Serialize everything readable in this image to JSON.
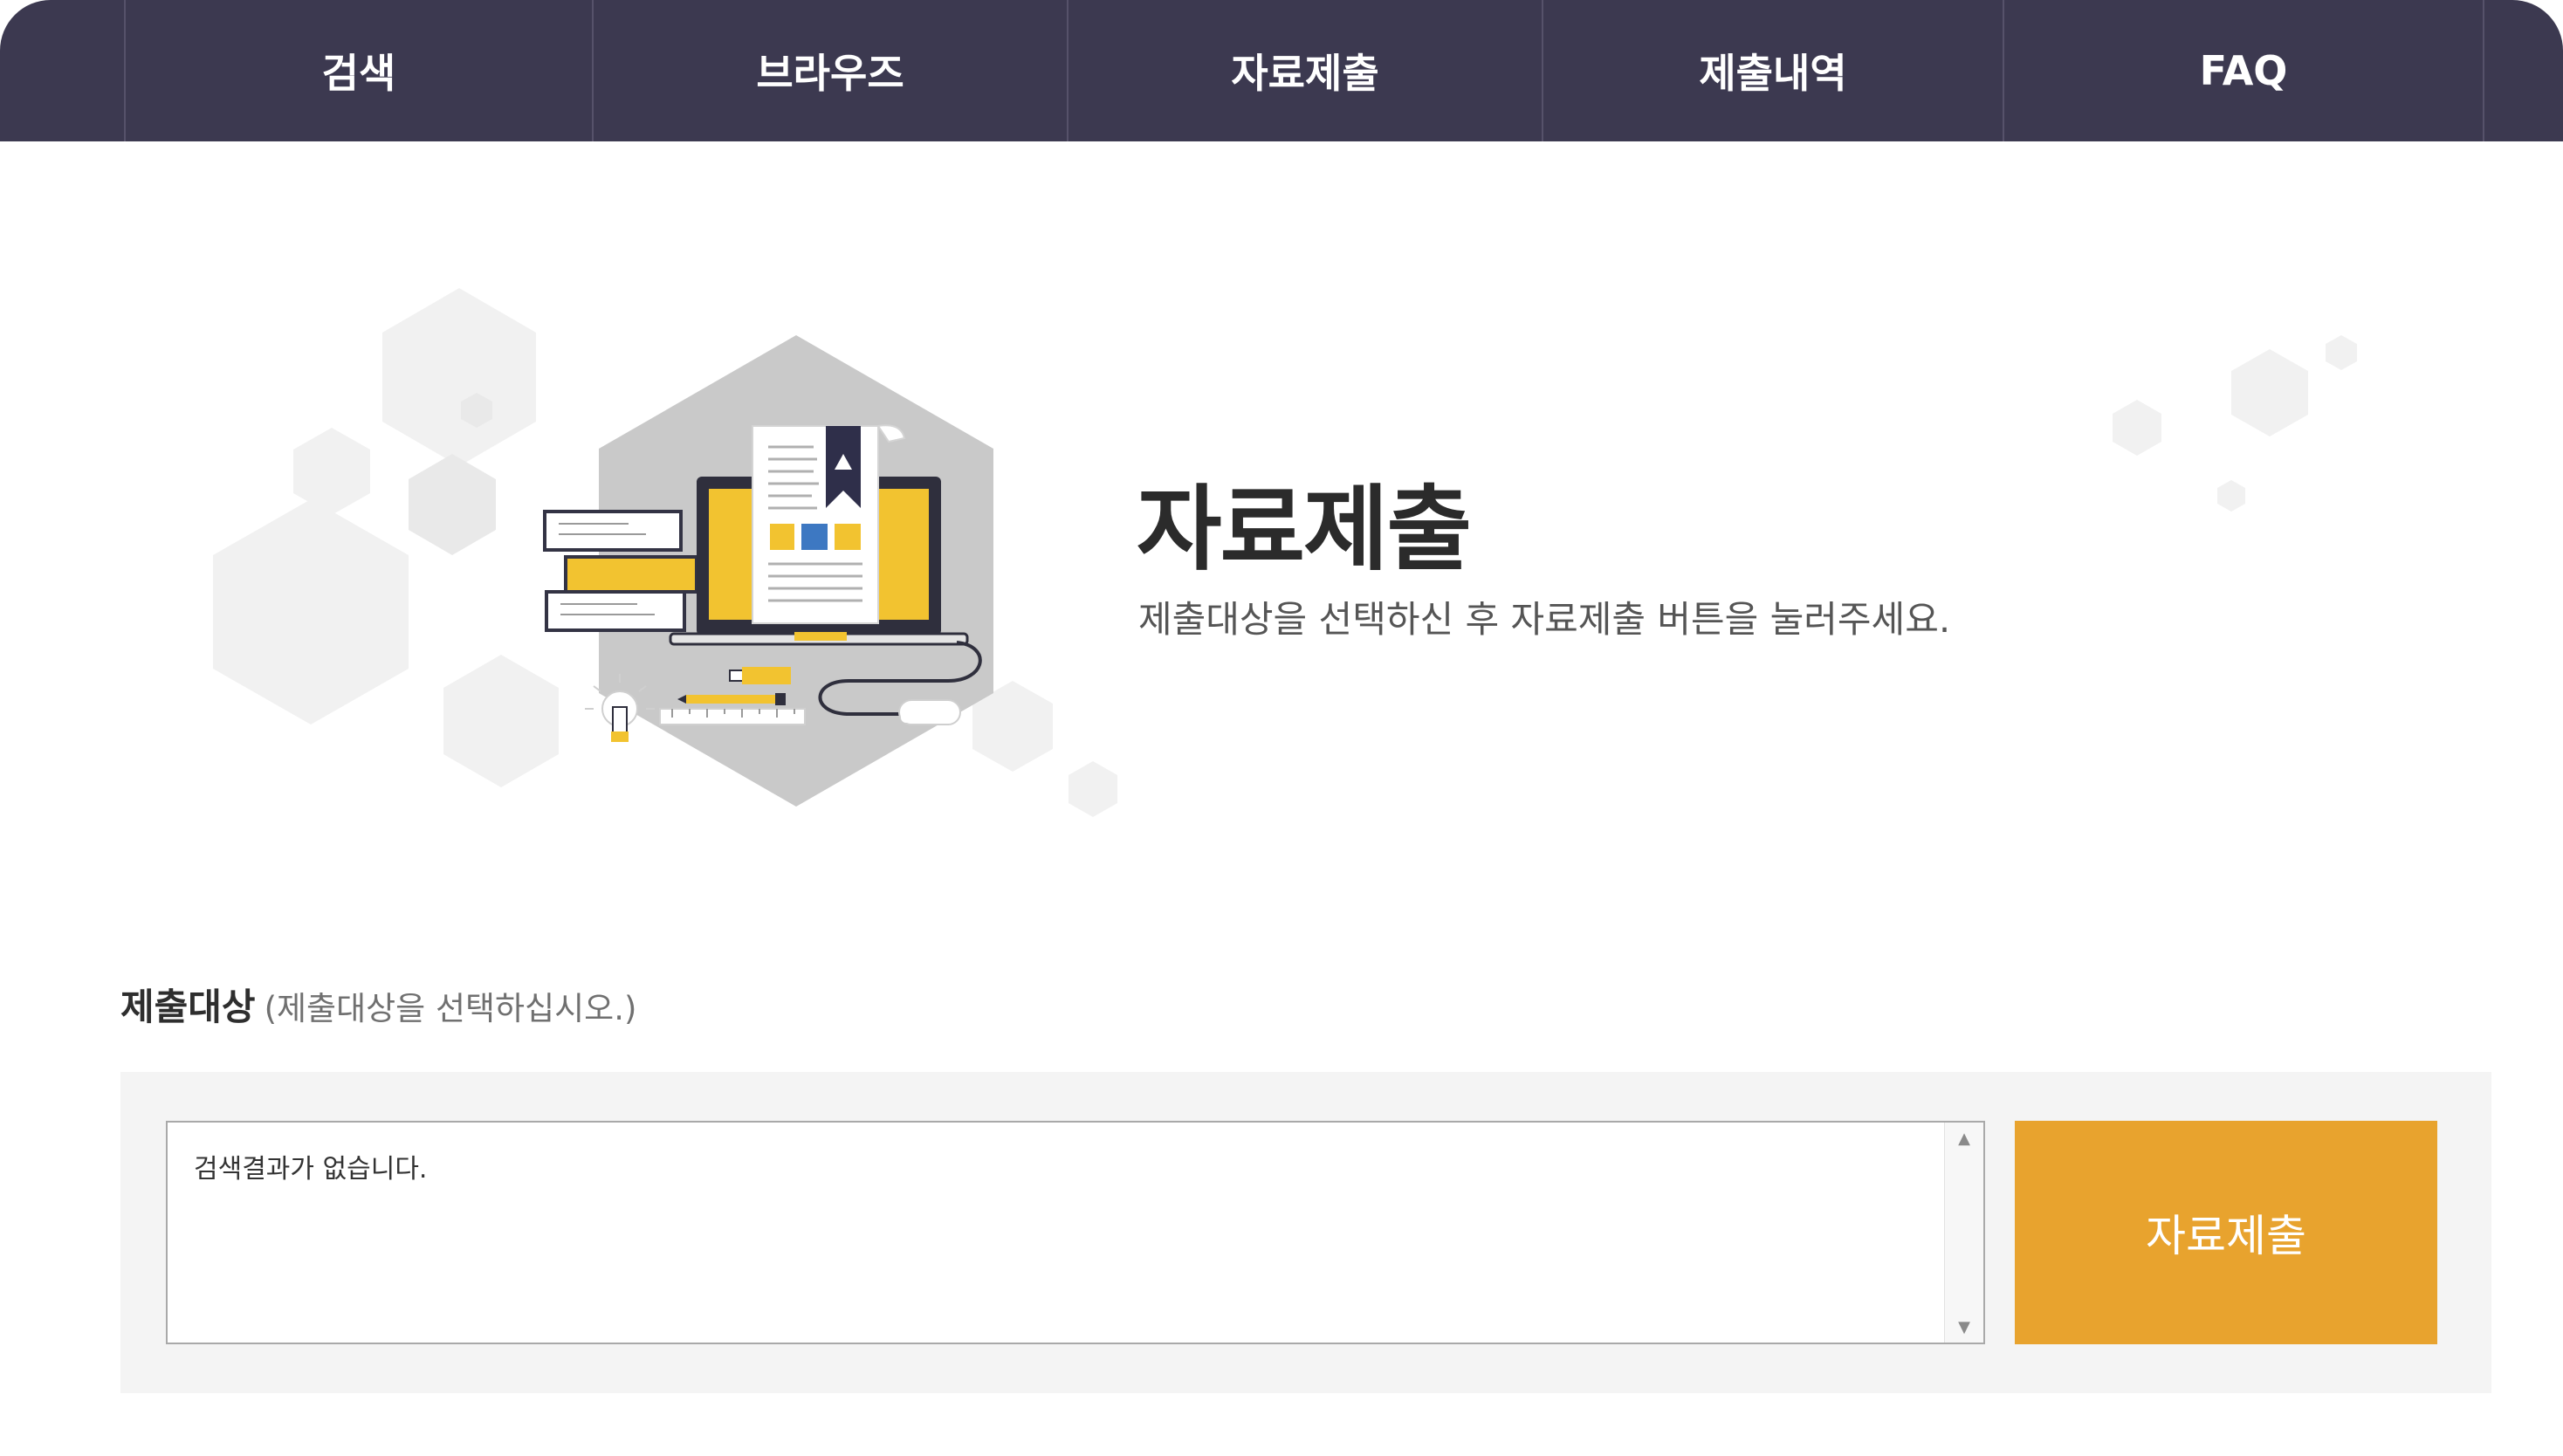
{
  "nav": {
    "items": [
      {
        "label": "검색"
      },
      {
        "label": "브라우즈"
      },
      {
        "label": "자료제출"
      },
      {
        "label": "제출내역"
      },
      {
        "label": "FAQ"
      }
    ]
  },
  "hero": {
    "title": "자료제출",
    "subtitle": "제출대상을 선택하신 후 자료제출 버튼을 눌러주세요."
  },
  "target": {
    "label": "제출대상",
    "hint": "(제출대상을 선택하십시오.)",
    "empty_text": "검색결과가 없습니다."
  },
  "submit_button": {
    "label": "자료제출"
  },
  "colors": {
    "nav_bg": "#3c3950",
    "accent": "#e8a32e",
    "illustration_yellow": "#f2c330",
    "illustration_blue": "#3d78c2"
  },
  "icons": {
    "illustration": "document-submission-illustration",
    "scroll_up": "scroll-up-arrow-icon",
    "scroll_down": "scroll-down-arrow-icon"
  }
}
